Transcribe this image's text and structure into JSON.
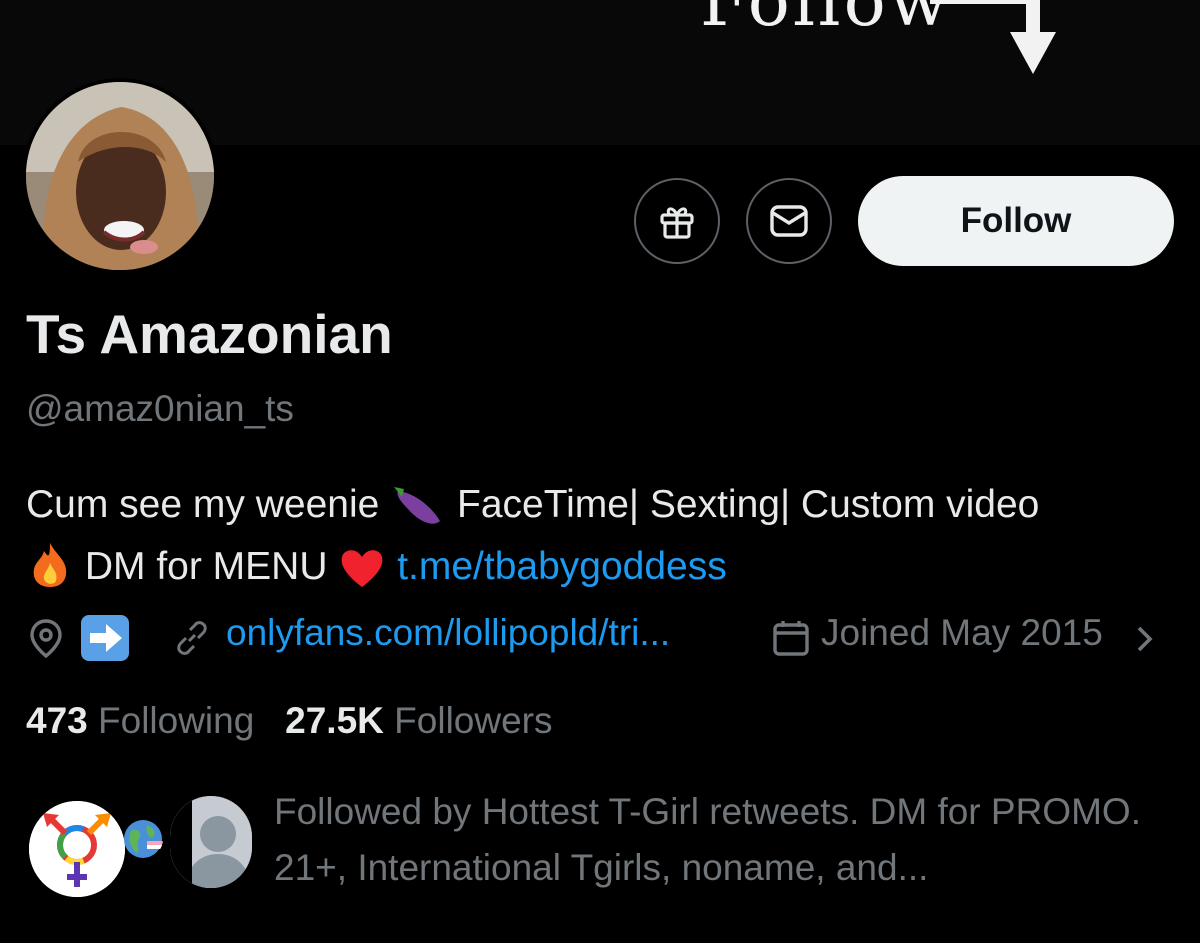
{
  "banner": {
    "text": "Follow"
  },
  "profile": {
    "name": "Ts Amazonian",
    "handle": "@amaz0nian_ts",
    "bio": {
      "part1": "Cum see my weenie",
      "part2": "FaceTime| Sexting| Custom video",
      "part3": "DM for MENU",
      "link": "t.me/tbabygoddess"
    }
  },
  "actions": {
    "follow_label": "Follow",
    "gift_icon": "gift-icon",
    "message_icon": "envelope-icon"
  },
  "meta": {
    "location_icon": "location-pin-icon",
    "location_emoji": "right-arrow-emoji",
    "website": "onlyfans.com/lollipopld/tri...",
    "joined": "Joined May 2015"
  },
  "stats": {
    "following_count": "473",
    "following_label": "Following",
    "followers_count": "27.5K",
    "followers_label": "Followers"
  },
  "followed_by": {
    "text": "Followed by Hottest T-Girl retweets. DM for PROMO. 21+, International Tgirls, noname, and..."
  },
  "colors": {
    "background": "#000000",
    "text_primary": "#e7e9ea",
    "text_secondary": "#71767b",
    "link": "#1d9bf0",
    "follow_button": "#eff3f4"
  }
}
